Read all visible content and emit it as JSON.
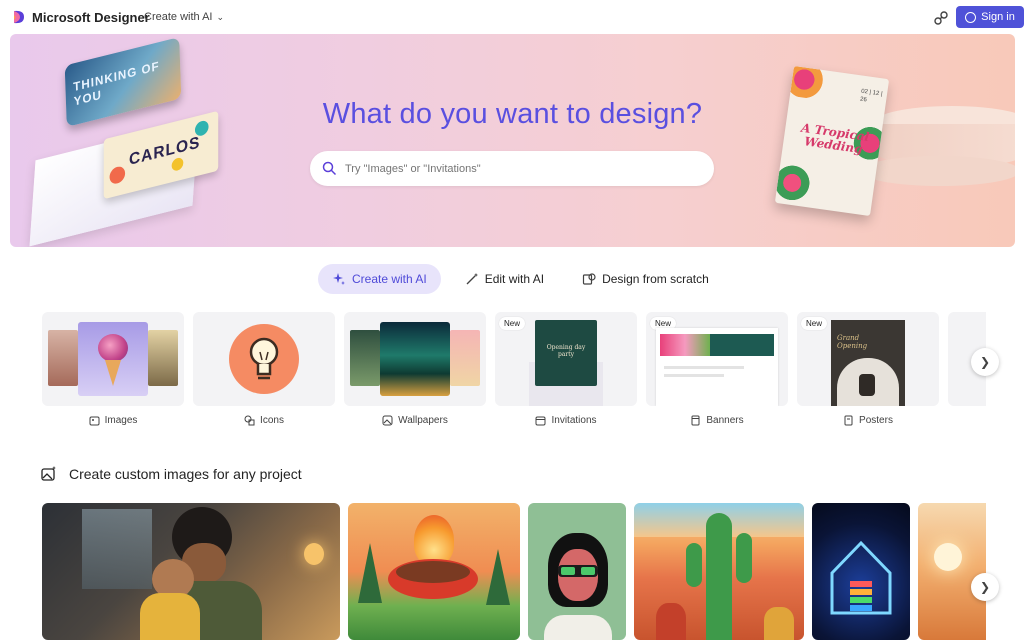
{
  "topbar": {
    "brand": "Microsoft Designer",
    "create_menu": "Create with AI",
    "signin_label": "Sign in",
    "icons": {
      "logo": "designer-logo",
      "share": "share-link-icon",
      "user": "person-icon",
      "chevron": "chevron-down-icon"
    }
  },
  "hero": {
    "title": "What do you want to design?",
    "search_placeholder": "Try \"Images\" or \"Invitations\"",
    "card1_text": "THINKING OF YOU",
    "card2_text": "CARLOS",
    "wedding_title": "A Tropical Wedding",
    "wedding_date": "02 | 12 | 26"
  },
  "modes": [
    {
      "label": "Create with AI",
      "active": true,
      "icon": "sparkle-icon"
    },
    {
      "label": "Edit with AI",
      "active": false,
      "icon": "magic-wand-icon"
    },
    {
      "label": "Design from scratch",
      "active": false,
      "icon": "design-shapes-icon"
    }
  ],
  "categories": [
    {
      "label": "Images",
      "badge": "",
      "icon": "image-sparkle-icon"
    },
    {
      "label": "Icons",
      "badge": "",
      "icon": "shapes-icon"
    },
    {
      "label": "Wallpapers",
      "badge": "",
      "icon": "wallpaper-icon"
    },
    {
      "label": "Invitations",
      "badge": "New",
      "invite_title": "Opening day party",
      "icon": "calendar-icon"
    },
    {
      "label": "Banners",
      "badge": "New",
      "icon": "banner-icon"
    },
    {
      "label": "Posters",
      "badge": "New",
      "poster_title": "Grand Opening",
      "icon": "poster-icon"
    }
  ],
  "section": {
    "title": "Create custom images for any project",
    "icon": "image-add-icon"
  },
  "colors": {
    "accent": "#4f52d8",
    "hero_title": "#5a4fe0",
    "active_mode_bg": "#e8e4fb"
  }
}
